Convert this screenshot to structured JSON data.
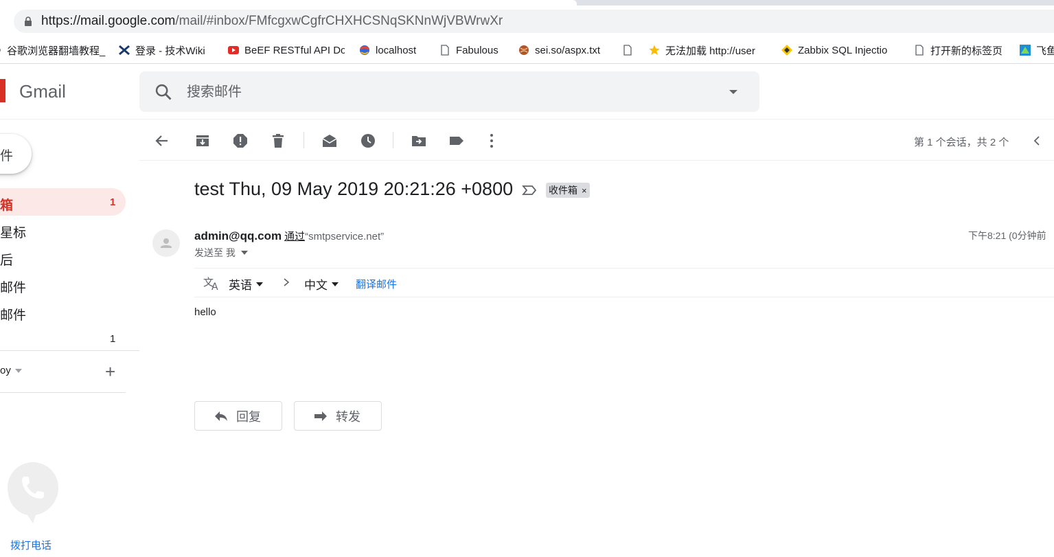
{
  "browser": {
    "url_main": "https://mail.google.com",
    "url_rest": "/mail/#inbox/FMfcgxwCgfrCHXHCSNqSKNnWjVBWrwXr",
    "bookmarks": [
      {
        "label": "谷歌浏览器翻墙教程_",
        "icon": "bookmark-folder-icon"
      },
      {
        "label": "登录 - 技术Wiki",
        "icon": "wiki-icon"
      },
      {
        "label": "BeEF RESTful API Do",
        "icon": "youtube-icon"
      },
      {
        "label": "localhost",
        "icon": "globe-icon"
      },
      {
        "label": "Fabulous",
        "icon": "page-icon"
      },
      {
        "label": "sei.so/aspx.txt",
        "icon": "ball-icon"
      },
      {
        "label": "",
        "icon": "page-icon"
      },
      {
        "label": "无法加载 http://user",
        "icon": "star-icon"
      },
      {
        "label": "Zabbix SQL Injectio",
        "icon": "zabbix-icon"
      },
      {
        "label": "打开新的标签页",
        "icon": "page-icon"
      },
      {
        "label": "飞鱼",
        "icon": "app-icon"
      }
    ]
  },
  "gmail": {
    "logo_text": "Gmail",
    "search_placeholder": "搜索邮件"
  },
  "sidebar": {
    "compose_label": "件",
    "items": [
      {
        "label": "箱",
        "count": "1"
      },
      {
        "label": "星标",
        "count": ""
      },
      {
        "label": "后",
        "count": ""
      },
      {
        "label": "邮件",
        "count": ""
      },
      {
        "label": "邮件",
        "count": ""
      },
      {
        "label": "",
        "count": "1"
      }
    ],
    "account_label": "oy",
    "add_label": "+",
    "call_label": "拨打电话"
  },
  "toolbar": {
    "pager": "第 1 个会话，共 2 个"
  },
  "message": {
    "subject": "test Thu, 09 May 2019 20:21:26 +0800",
    "label": "收件箱",
    "label_close": "×",
    "sender": "admin@qq.com",
    "via": "通过",
    "service": "“smtpservice.net”",
    "to": "发送至 我",
    "time": "下午8:21 (0分钟前",
    "body": "hello"
  },
  "translate": {
    "from": "英语",
    "to": "中文",
    "link": "翻译邮件"
  },
  "actions": {
    "reply": "回复",
    "forward": "转发"
  },
  "colors": {
    "accent_red": "#d93025",
    "nav_active_bg": "#fce8e6",
    "link_blue": "#1a73e8"
  }
}
